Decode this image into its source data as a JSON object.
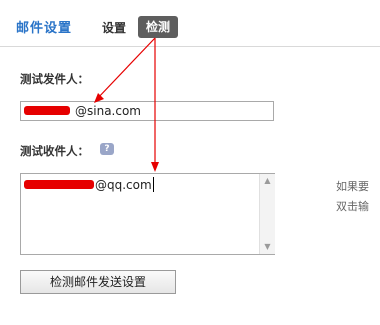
{
  "header": {
    "title": "邮件设置",
    "tabs": [
      {
        "label": "设置",
        "active": false
      },
      {
        "label": "检测",
        "active": true
      }
    ]
  },
  "form": {
    "sender_label": "测试发件人：",
    "sender_value": "@sina.com",
    "recipient_label": "测试收件人：",
    "recipient_value": "@qq.com",
    "hint_lines": [
      "如果要",
      "双击输"
    ],
    "submit_label": "检测邮件发送设置"
  },
  "colors": {
    "accent": "#2a74c8",
    "active_tab_bg": "#5e5e5e",
    "annotation_red": "#e60000"
  },
  "icons": {
    "help": "help-icon",
    "scroll_up": "arrow-up-icon",
    "scroll_down": "arrow-down-icon"
  }
}
